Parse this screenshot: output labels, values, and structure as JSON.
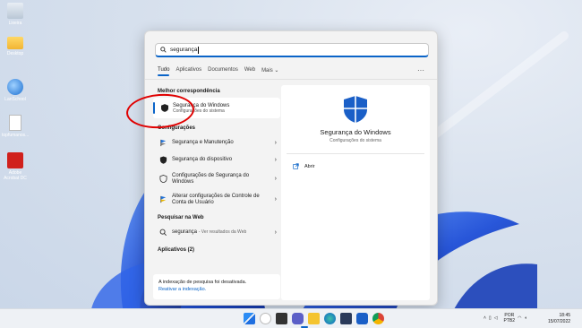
{
  "desktop": {
    "icons": [
      {
        "label": "Lixeira",
        "icon": "recycle-bin-icon"
      },
      {
        "label": "Desktop",
        "icon": "folder-icon"
      },
      {
        "label": "LanSchool",
        "icon": "network-globe-icon"
      },
      {
        "label": "topfumanos...",
        "icon": "document-icon"
      },
      {
        "label": "Adobe Acrobat DC",
        "icon": "acrobat-icon"
      }
    ]
  },
  "search": {
    "query": "segurança",
    "tabs": [
      "Tudo",
      "Aplicativos",
      "Documentos",
      "Web",
      "Mais"
    ],
    "more_chevron": "⌄",
    "options_glyph": "···"
  },
  "left_panel": {
    "best_match_title": "Melhor correspondência",
    "best_match": {
      "name": "Segurança do Windows",
      "subtitle": "Configurações do sistema"
    },
    "settings_title": "Configurações",
    "settings_items": [
      {
        "label": "Segurança e Manutenção",
        "icon": "flag-icon"
      },
      {
        "label": "Segurança do dispositivo",
        "icon": "shield-icon"
      },
      {
        "label": "Configurações de Segurança do Windows",
        "icon": "shield-outline-icon"
      },
      {
        "label": "Alterar configurações de Controle de Conta de Usuário",
        "icon": "uac-flag-icon"
      }
    ],
    "web_title": "Pesquisar na Web",
    "web_item": {
      "query": "segurança",
      "sub": "- Ver resultados da Web"
    },
    "apps_title": "Aplicativos (2)",
    "notice": {
      "text": "A indexação de pesquisa foi desativada.",
      "link": "Reativar a indexação."
    }
  },
  "right_panel": {
    "title": "Segurança do Windows",
    "subtitle": "Configurações do sistema",
    "action": "Abrir"
  },
  "taskbar": {
    "language": "POR",
    "layout": "PTB2",
    "time": "18:45",
    "date": "15/07/2022"
  },
  "colors": {
    "accent": "#0a64c8",
    "highlight_circle": "#e00000",
    "bloom": "#1f4fd8"
  }
}
